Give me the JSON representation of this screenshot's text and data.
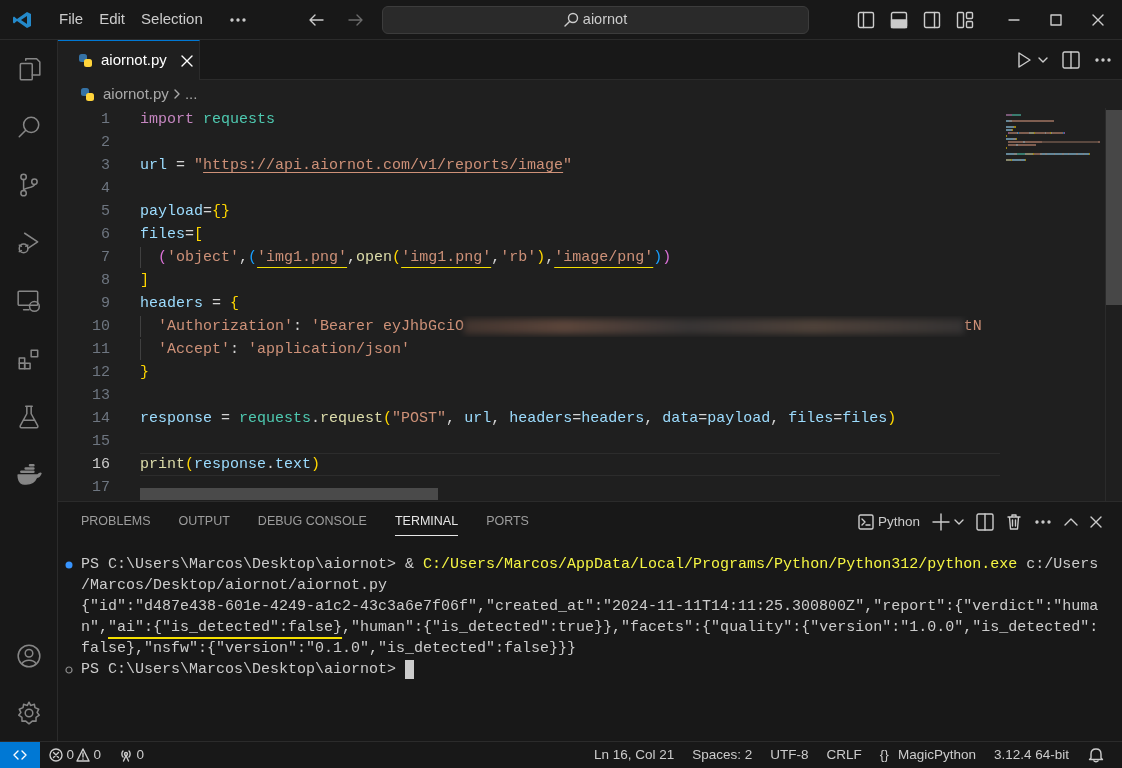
{
  "title_bar": {
    "menus": [
      "File",
      "Edit",
      "Selection"
    ],
    "search": {
      "value": "aiornot"
    }
  },
  "tabs": [
    {
      "label": "aiornot.py",
      "selected": true
    }
  ],
  "breadcrumb": {
    "file": "aiornot.py",
    "more": "..."
  },
  "code_lines": [
    {
      "number": "1",
      "selected": false,
      "indented": false,
      "tokens": [
        {
          "text": "import",
          "kind": "kw"
        },
        {
          "text": " requests",
          "kind": "mod"
        }
      ]
    },
    {
      "number": "2",
      "selected": false,
      "indented": false
    },
    {
      "number": "3",
      "selected": false,
      "indented": false,
      "tokens": [
        {
          "text": "url",
          "kind": "var"
        },
        {
          "text": " = ",
          "kind": "op"
        },
        {
          "text": "\"",
          "kind": "str"
        },
        {
          "text": "https://api.aiornot.com/v1/reports/image",
          "kind": "link"
        },
        {
          "text": "\"",
          "kind": "str"
        }
      ]
    },
    {
      "number": "4",
      "selected": false,
      "indented": false
    },
    {
      "number": "5",
      "selected": false,
      "indented": false,
      "tokens": [
        {
          "text": "payload",
          "kind": "var"
        },
        {
          "text": "=",
          "kind": "op"
        },
        {
          "text": "{}",
          "kind": "b1"
        }
      ]
    },
    {
      "number": "6",
      "selected": false,
      "indented": false,
      "tokens": [
        {
          "text": "files",
          "kind": "var"
        },
        {
          "text": "=",
          "kind": "op"
        },
        {
          "text": "[",
          "kind": "b1"
        }
      ]
    },
    {
      "number": "7",
      "selected": false,
      "indented": true,
      "tokens": [
        {
          "text": "(",
          "kind": "b2"
        },
        {
          "text": "'object'",
          "kind": "str"
        },
        {
          "text": ",",
          "kind": "op"
        },
        {
          "text": "(",
          "kind": "b3"
        },
        {
          "text": "'img1.png'",
          "kind": "str",
          "underlined": true
        },
        {
          "text": ",",
          "kind": "op"
        },
        {
          "text": "open",
          "kind": "fn"
        },
        {
          "text": "(",
          "kind": "b1"
        },
        {
          "text": "'img1.png'",
          "kind": "str",
          "underlined": true
        },
        {
          "text": ",",
          "kind": "op"
        },
        {
          "text": "'rb'",
          "kind": "str"
        },
        {
          "text": ")",
          "kind": "b1"
        },
        {
          "text": ",",
          "kind": "op"
        },
        {
          "text": "'image/png'",
          "kind": "str",
          "underlined": true
        },
        {
          "text": ")",
          "kind": "b3"
        },
        {
          "text": ")",
          "kind": "b2"
        }
      ]
    },
    {
      "number": "8",
      "selected": false,
      "indented": false,
      "tokens": [
        {
          "text": "]",
          "kind": "b1"
        }
      ]
    },
    {
      "number": "9",
      "selected": false,
      "indented": false,
      "tokens": [
        {
          "text": "headers",
          "kind": "var"
        },
        {
          "text": " = ",
          "kind": "op"
        },
        {
          "text": "{",
          "kind": "b1"
        }
      ]
    },
    {
      "number": "10",
      "selected": false,
      "indented": true,
      "tokens": [
        {
          "text": "'Authorization'",
          "kind": "str"
        },
        {
          "text": ": ",
          "kind": "op"
        },
        {
          "text": "'Bearer eyJhbGciO",
          "kind": "str"
        },
        {
          "kind": "redacted"
        },
        {
          "text": "tN",
          "kind": "str"
        }
      ]
    },
    {
      "number": "11",
      "selected": false,
      "indented": true,
      "tokens": [
        {
          "text": "'Accept'",
          "kind": "str"
        },
        {
          "text": ": ",
          "kind": "op"
        },
        {
          "text": "'application/json'",
          "kind": "str"
        }
      ]
    },
    {
      "number": "12",
      "selected": false,
      "indented": false,
      "tokens": [
        {
          "text": "}",
          "kind": "b1"
        }
      ]
    },
    {
      "number": "13",
      "selected": false,
      "indented": false
    },
    {
      "number": "14",
      "selected": false,
      "indented": false,
      "tokens": [
        {
          "text": "response",
          "kind": "var"
        },
        {
          "text": " = ",
          "kind": "op"
        },
        {
          "text": "requests",
          "kind": "mod"
        },
        {
          "text": ".",
          "kind": "op"
        },
        {
          "text": "request",
          "kind": "fn"
        },
        {
          "text": "(",
          "kind": "b1"
        },
        {
          "text": "\"POST\"",
          "kind": "str"
        },
        {
          "text": ", ",
          "kind": "op"
        },
        {
          "text": "url",
          "kind": "var"
        },
        {
          "text": ", ",
          "kind": "op"
        },
        {
          "text": "headers",
          "kind": "var"
        },
        {
          "text": "=",
          "kind": "op"
        },
        {
          "text": "headers",
          "kind": "var"
        },
        {
          "text": ", ",
          "kind": "op"
        },
        {
          "text": "data",
          "kind": "var"
        },
        {
          "text": "=",
          "kind": "op"
        },
        {
          "text": "payload",
          "kind": "var"
        },
        {
          "text": ", ",
          "kind": "op"
        },
        {
          "text": "files",
          "kind": "var"
        },
        {
          "text": "=",
          "kind": "op"
        },
        {
          "text": "files",
          "kind": "var"
        },
        {
          "text": ")",
          "kind": "b1"
        }
      ]
    },
    {
      "number": "15",
      "selected": false,
      "indented": false
    },
    {
      "number": "16",
      "selected": true,
      "indented": false,
      "tokens": [
        {
          "text": "print",
          "kind": "fn"
        },
        {
          "text": "(",
          "kind": "b1"
        },
        {
          "text": "response",
          "kind": "var"
        },
        {
          "text": ".",
          "kind": "op"
        },
        {
          "text": "text",
          "kind": "var"
        },
        {
          "text": ")",
          "kind": "b1"
        }
      ]
    },
    {
      "number": "17",
      "selected": false,
      "indented": false
    }
  ],
  "panel": {
    "tabs": [
      {
        "label": "PROBLEMS",
        "selected": false
      },
      {
        "label": "OUTPUT",
        "selected": false
      },
      {
        "label": "DEBUG CONSOLE",
        "selected": false
      },
      {
        "label": "TERMINAL",
        "selected": true
      },
      {
        "label": "PORTS",
        "selected": false
      }
    ],
    "terminal_profile": "Python",
    "terminal_lines": [
      {
        "kind": "finished",
        "cursor": false,
        "spans": [
          {
            "text": "PS C:\\Users\\Marcos\\Desktop\\aiornot> & ",
            "kind": "plain"
          },
          {
            "text": "C:/Users/Marcos/AppData/Local/Programs/Python/Python312/python.exe",
            "kind": "path"
          },
          {
            "text": " c:/Users",
            "kind": "plain"
          }
        ]
      },
      {
        "kind": "output",
        "cursor": false,
        "spans": [
          {
            "text": "/Marcos/Desktop/aiornot/aiornot.py",
            "kind": "plain"
          }
        ]
      },
      {
        "kind": "output",
        "cursor": false,
        "spans": [
          {
            "text": "{\"id\":\"d487e438-601e-4249-a1c2-43c3a6e7f06f\",\"created_at\":\"2024-11-11T14:11:25.300800Z\",\"report\":{\"verdict\":\"huma",
            "kind": "plain"
          }
        ]
      },
      {
        "kind": "output",
        "cursor": false,
        "spans": [
          {
            "text": "n\",",
            "kind": "plain"
          },
          {
            "text": "\"ai\":{\"is_detected\":false}",
            "kind": "plain",
            "underlined": true
          },
          {
            "text": ",\"human\":{\"is_detected\":true}},\"facets\":{\"quality\":{\"version\":\"1.0.0\",\"is_detected\":",
            "kind": "plain"
          }
        ]
      },
      {
        "kind": "output",
        "cursor": false,
        "spans": [
          {
            "text": "false},\"nsfw\":{\"version\":\"0.1.0\",\"is_detected\":false}}}",
            "kind": "plain"
          }
        ]
      },
      {
        "kind": "prompt",
        "cursor": true,
        "spans": [
          {
            "text": "PS C:\\Users\\Marcos\\Desktop\\aiornot> ",
            "kind": "plain"
          }
        ]
      }
    ]
  },
  "status_bar": [
    {
      "kind": "errors",
      "text": "0"
    },
    {
      "kind": "warnings",
      "text": "0"
    },
    {
      "kind": "ports",
      "text": "0"
    },
    {
      "kind": "spacer"
    },
    {
      "kind": "text",
      "text": "Ln 16, Col 21"
    },
    {
      "kind": "text",
      "text": "Spaces: 2"
    },
    {
      "kind": "text",
      "text": "UTF-8"
    },
    {
      "kind": "text",
      "text": "CRLF"
    },
    {
      "kind": "glyph",
      "text": "{}"
    },
    {
      "kind": "text",
      "text": "MagicPython"
    },
    {
      "kind": "text",
      "text": "3.12.4 64-bit"
    },
    {
      "kind": "bell"
    }
  ]
}
